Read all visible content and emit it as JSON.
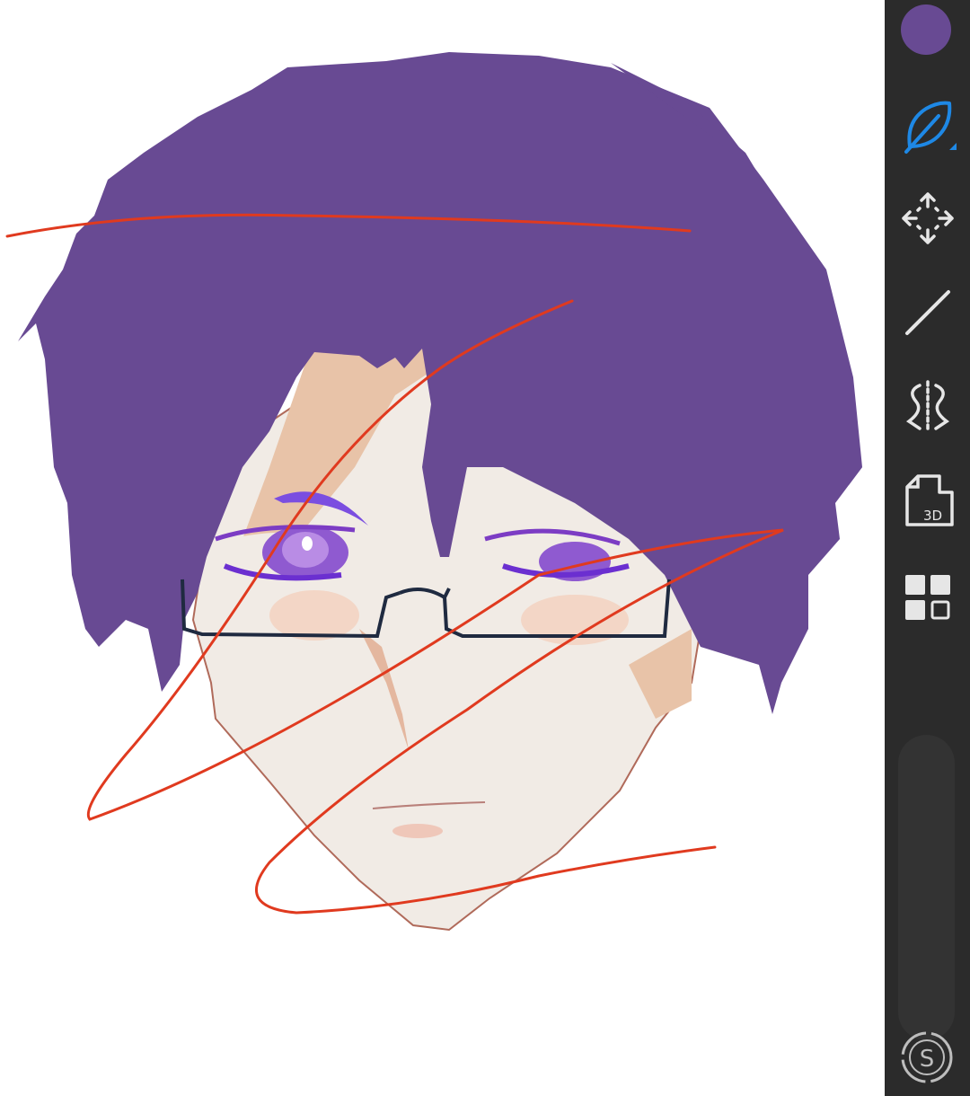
{
  "app": {
    "current_color": "#684a93",
    "accent_color": "#1e88e5",
    "toolbar_bg": "#2b2b2b"
  },
  "toolbar": {
    "tools": [
      {
        "id": "brush",
        "icon": "leaf-brush-icon",
        "active": true
      },
      {
        "id": "transform",
        "icon": "move-arrows-icon",
        "active": false
      },
      {
        "id": "ruler",
        "icon": "ruler-line-icon",
        "active": false
      },
      {
        "id": "symmetry",
        "icon": "symmetry-icon",
        "active": false
      },
      {
        "id": "3d",
        "icon": "file-3d-icon",
        "label": "3D",
        "active": false
      },
      {
        "id": "layers",
        "icon": "layers-grid-icon",
        "active": false
      }
    ],
    "brand_icon": "s-logo-icon"
  },
  "drawing": {
    "hair_color": "#684a93",
    "skin_color": "#f1ebe5",
    "stroke_color": "#e03a1f",
    "glasses_color": "#1f2a40",
    "eye_color": "#8f5ad0"
  }
}
